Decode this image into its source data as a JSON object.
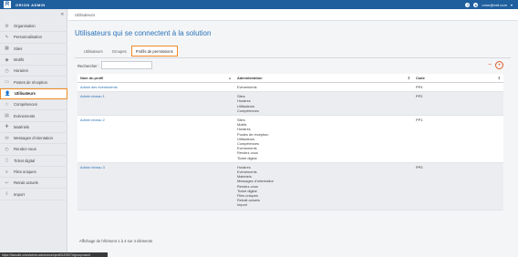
{
  "topbar": {
    "logo_letter": "R",
    "logo_text": "ORION ADMIN",
    "user_email": "orion@exil.com",
    "help": "?"
  },
  "breadcrumb": "Utilisateurs",
  "sidebar": {
    "collapse": "«",
    "items": [
      {
        "label": "Organisation",
        "icon": "gear-icon",
        "glyph": "⚙"
      },
      {
        "label": "Personnalisation",
        "icon": "brush-icon",
        "glyph": "✎"
      },
      {
        "label": "Sites",
        "icon": "building-icon",
        "glyph": "▦"
      },
      {
        "label": "Motifs",
        "icon": "tag-icon",
        "glyph": "◆"
      },
      {
        "label": "Horaires",
        "icon": "clock-icon",
        "glyph": "◷"
      },
      {
        "label": "Postes de réception",
        "icon": "desk-icon",
        "glyph": "▭"
      },
      {
        "label": "Utilisateurs",
        "icon": "user-icon",
        "glyph": "👤"
      },
      {
        "label": "Compétences",
        "icon": "star-icon",
        "glyph": "☆"
      },
      {
        "label": "Evènements",
        "icon": "calendar-icon",
        "glyph": "▤"
      },
      {
        "label": "Matériels",
        "icon": "tool-icon",
        "glyph": "✚"
      },
      {
        "label": "Messages d'orientation",
        "icon": "message-icon",
        "glyph": "✉"
      },
      {
        "label": "Rendez-vous",
        "icon": "appointment-icon",
        "glyph": "◴"
      },
      {
        "label": "Ticket digital",
        "icon": "ticket-icon",
        "glyph": "▯"
      },
      {
        "label": "Files uniques",
        "icon": "queue-icon",
        "glyph": "≡"
      },
      {
        "label": "Retrait actuels",
        "icon": "withdraw-icon",
        "glyph": "↩"
      },
      {
        "label": "Import",
        "icon": "import-icon",
        "glyph": "⇩"
      }
    ],
    "active_index": 6
  },
  "page": {
    "title": "Utilisateurs qui se connectent à la solution",
    "tabs": [
      "Utilisateurs",
      "Groupes",
      "Profils de permissions"
    ],
    "active_tab": 2,
    "search_label": "Rechercher :",
    "search_value": "",
    "minus": "−",
    "plus": "+"
  },
  "table": {
    "headers": [
      "Nom du profil",
      "Administration",
      "Code"
    ],
    "rows": [
      {
        "name": "Admin des évènements",
        "admin": [
          "Evènements"
        ],
        "code": "PP4"
      },
      {
        "name": "Admin niveau 1",
        "admin": [
          "Sites",
          "Horaires",
          "Utilisateurs",
          "Compétences"
        ],
        "code": "PP2"
      },
      {
        "name": "Admin niveau 2",
        "admin": [
          "Sites",
          "Motifs",
          "Horaires",
          "Postes de réception",
          "Utilisateurs",
          "Compétences",
          "Evènements",
          "Rendez-vous",
          "Ticket digital"
        ],
        "code": "PP1"
      },
      {
        "name": "Admin niveau 3",
        "admin": [
          "Horaires",
          "Evènements",
          "Matériels",
          "Messages d'orientation",
          "Rendez-vous",
          "Ticket digital",
          "Files uniques",
          "Retrait actuels",
          "Import"
        ],
        "code": "PP3"
      }
    ]
  },
  "footer": "Affichage de l'élément 1 à 4 sur 4 éléments",
  "status_url": "https://fassuite.orion/admin-admin/user/profil/1878074/group/user#"
}
